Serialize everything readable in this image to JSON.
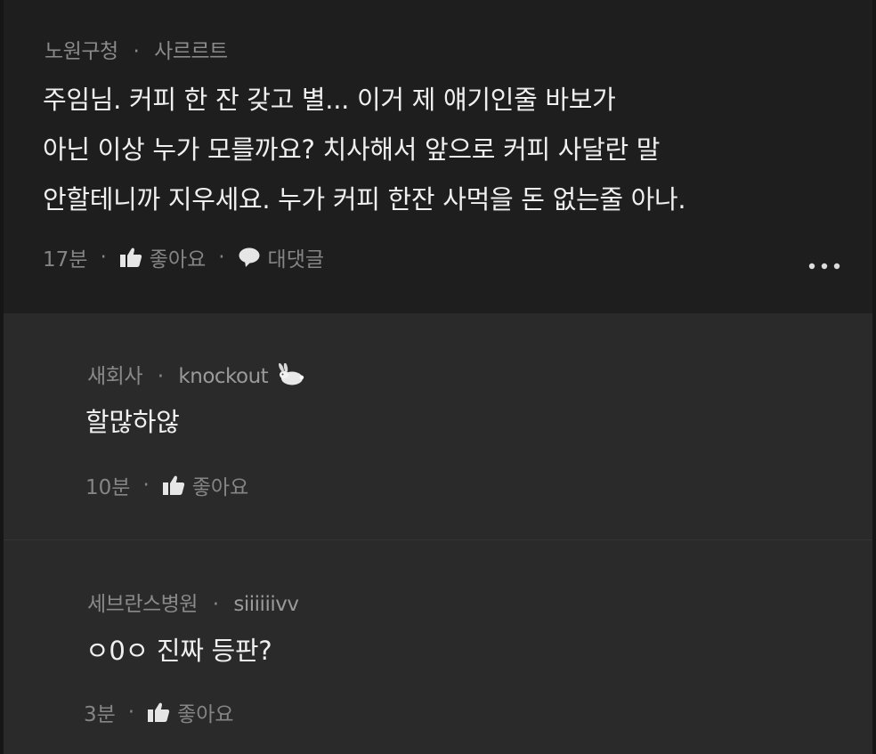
{
  "main": {
    "author": "노원구청",
    "handle": "사르르트",
    "lines": [
      "주임님. 커피 한 잔 갖고 별... 이거 제 얘기인줄 바보가",
      "아닌 이상 누가 모를까요? 치사해서 앞으로 커피 사달란 말",
      "안할테니까 지우세요. 누가 커피 한잔 사먹을 돈 없는줄 아나."
    ],
    "time": "17분",
    "like_label": "좋아요",
    "reply_label": "대댓글",
    "more_icon": "more-horizontal-icon"
  },
  "replies": [
    {
      "author": "새회사",
      "handle": "knockout",
      "text": "할많하않",
      "time": "10분",
      "like_label": "좋아요"
    },
    {
      "author": "세브란스병원",
      "handle": "siiiiiivv",
      "text": "ㅇ0ㅇ 진짜 등판?",
      "time": "3분",
      "like_label": "좋아요"
    }
  ],
  "separator": "·",
  "colors": {
    "background": "#2a2a2a",
    "main_background": "#1e1e1e",
    "text": "#f0f0f0",
    "meta": "#8a8a8a"
  }
}
